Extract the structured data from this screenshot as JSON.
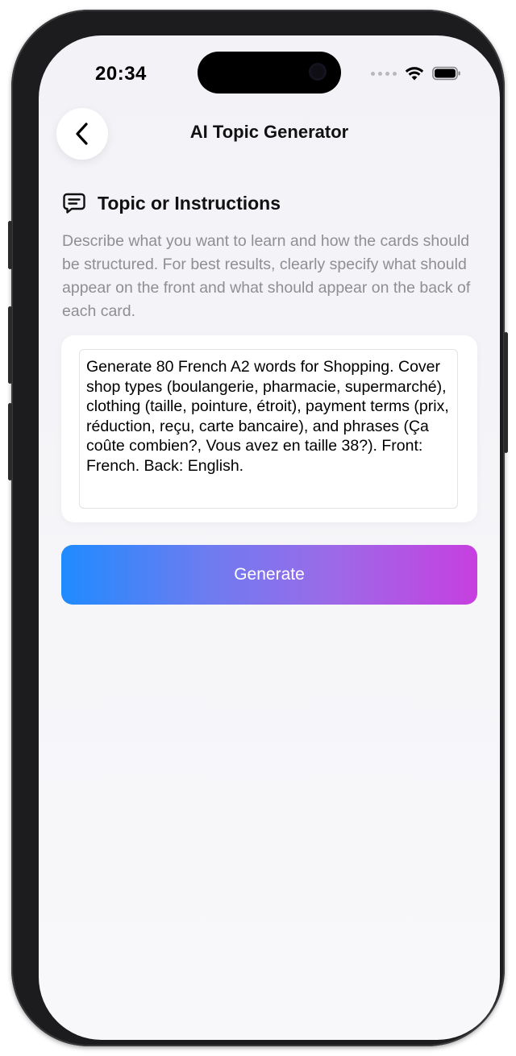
{
  "status_bar": {
    "time": "20:34"
  },
  "header": {
    "title": "AI Topic Generator",
    "back_icon": "chevron-left-icon"
  },
  "section": {
    "icon": "message-text-icon",
    "title": "Topic or Instructions",
    "description": "Describe what you want to learn and how the cards should be structured. For best results, clearly specify what should appear on the front and what should appear on the back of each card."
  },
  "input": {
    "value": "Generate 80 French A2 words for Shopping. Cover shop types (boulangerie, pharmacie, supermarché), clothing (taille, pointure, étroit), payment terms (prix, réduction, reçu, carte bancaire), and phrases (Ça coûte combien?, Vous avez en taille 38?). Front: French. Back: English."
  },
  "generate_button": {
    "label": "Generate"
  },
  "colors": {
    "gradient_start": "#1f8bff",
    "gradient_end": "#c73fe0",
    "background": "#f2f2f7"
  }
}
